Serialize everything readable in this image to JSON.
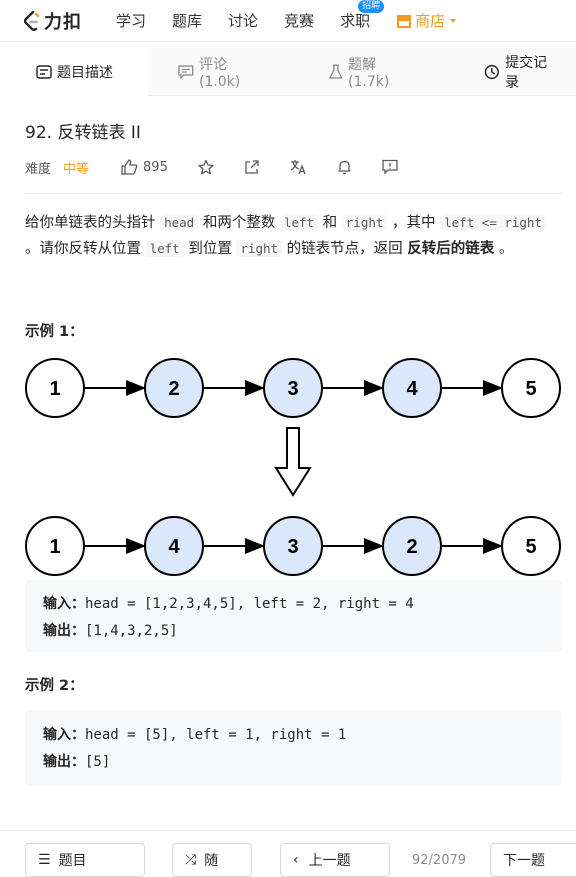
{
  "nav": {
    "logo": "力扣",
    "items": [
      "学习",
      "题库",
      "讨论",
      "竞赛",
      "求职"
    ],
    "badge": "招聘",
    "shop": "商店"
  },
  "tabs": {
    "description": "题目描述",
    "comments": "评论 (1.0k)",
    "solutions": "题解 (1.7k)",
    "submissions": "提交记录"
  },
  "problem": {
    "title": "92. 反转链表 II",
    "difficulty_label": "难度",
    "difficulty": "中等",
    "likes": "895"
  },
  "description": {
    "t1": "给你单链表的头指针 ",
    "c1": "head",
    "t2": " 和两个整数 ",
    "c2": "left",
    "t3": " 和 ",
    "c3": "right",
    "t4": " ，其中 ",
    "c4": "left <= right",
    "t5": " 。请你反转从位置 ",
    "c5": "left",
    "t6": " 到位置 ",
    "c6": "right",
    "t7": " 的链表节点，返回 ",
    "b1": "反转后的链表",
    "t8": " 。"
  },
  "example1": {
    "title": "示例 1：",
    "top_list": [
      "1",
      "2",
      "3",
      "4",
      "5"
    ],
    "bottom_list": [
      "1",
      "4",
      "3",
      "2",
      "5"
    ],
    "input_label": "输入：",
    "input": "head = [1,2,3,4,5], left = 2, right = 4",
    "output_label": "输出：",
    "output": "[1,4,3,2,5]"
  },
  "example2": {
    "title": "示例 2：",
    "input_label": "输入：",
    "input": "head = [5], left = 1, right = 1",
    "output_label": "输出：",
    "output": "[5]"
  },
  "bottom": {
    "list_btn": "题目",
    "random_btn": "随",
    "prev_btn": "上一题",
    "counter": "92/2079",
    "next_btn": "下一题"
  },
  "colors": {
    "highlight_node": "#dbe7fb",
    "plain_node": "#ffffff",
    "accent": "#ffa116"
  }
}
